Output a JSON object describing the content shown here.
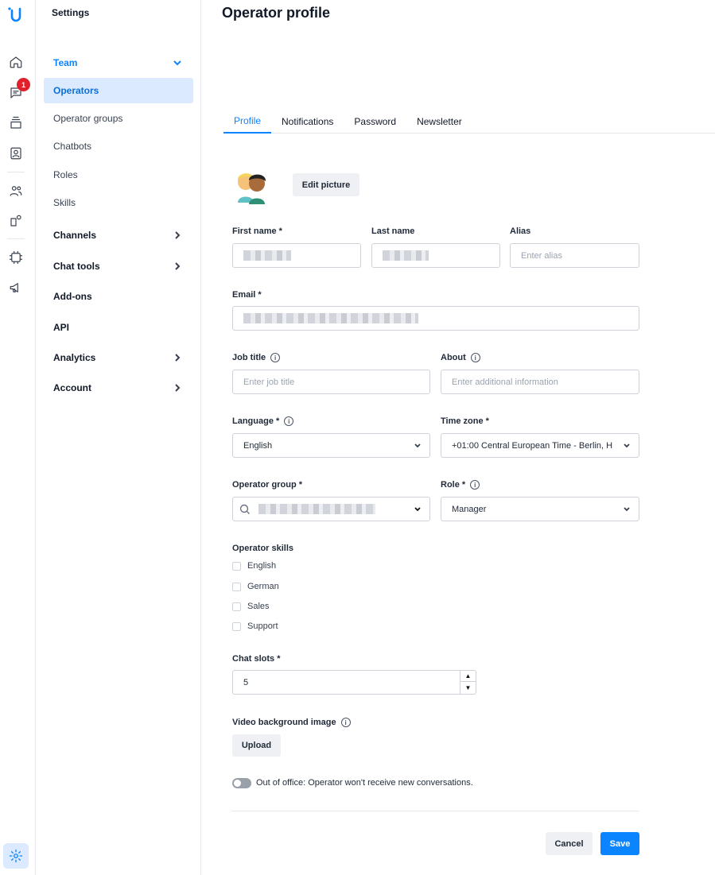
{
  "rail": {
    "logo": "U",
    "badge_count": "1",
    "icons": [
      "home-icon",
      "chat-icon",
      "inbox-icon",
      "contacts-icon",
      "team-icon",
      "integrations-icon",
      "ai-icon",
      "megaphone-icon",
      "gear-icon"
    ],
    "accent": "#0a84ff"
  },
  "sidebar": {
    "title": "Settings",
    "team": "Team",
    "items": {
      "operators": "Operators",
      "operator_groups": "Operator groups",
      "chatbots": "Chatbots",
      "roles": "Roles",
      "skills": "Skills"
    },
    "sections": {
      "channels": "Channels",
      "chat_tools": "Chat tools",
      "addons": "Add-ons",
      "api": "API",
      "analytics": "Analytics",
      "account": "Account"
    }
  },
  "page": {
    "title": "Operator profile",
    "tabs": [
      "Profile",
      "Notifications",
      "Password",
      "Newsletter"
    ],
    "edit_picture": "Edit picture",
    "labels": {
      "first_name": "First name *",
      "last_name": "Last name",
      "alias": "Alias",
      "email": "Email *",
      "job_title": "Job title",
      "about": "About",
      "language": "Language *",
      "time_zone": "Time zone *",
      "operator_group": "Operator group *",
      "role": "Role *",
      "operator_skills": "Operator skills",
      "chat_slots": "Chat slots *",
      "video_bg": "Video background image"
    },
    "placeholders": {
      "alias": "Enter alias",
      "job_title": "Enter job title",
      "about": "Enter additional information"
    },
    "values": {
      "language": "English",
      "time_zone": "+01:00 Central European Time - Berlin, H",
      "role": "Manager",
      "chat_slots": "5"
    },
    "skills": [
      "English",
      "German",
      "Sales",
      "Support"
    ],
    "upload": "Upload",
    "out_of_office": "Out of office: Operator won't receive new conversations.",
    "cancel": "Cancel",
    "save": "Save"
  }
}
